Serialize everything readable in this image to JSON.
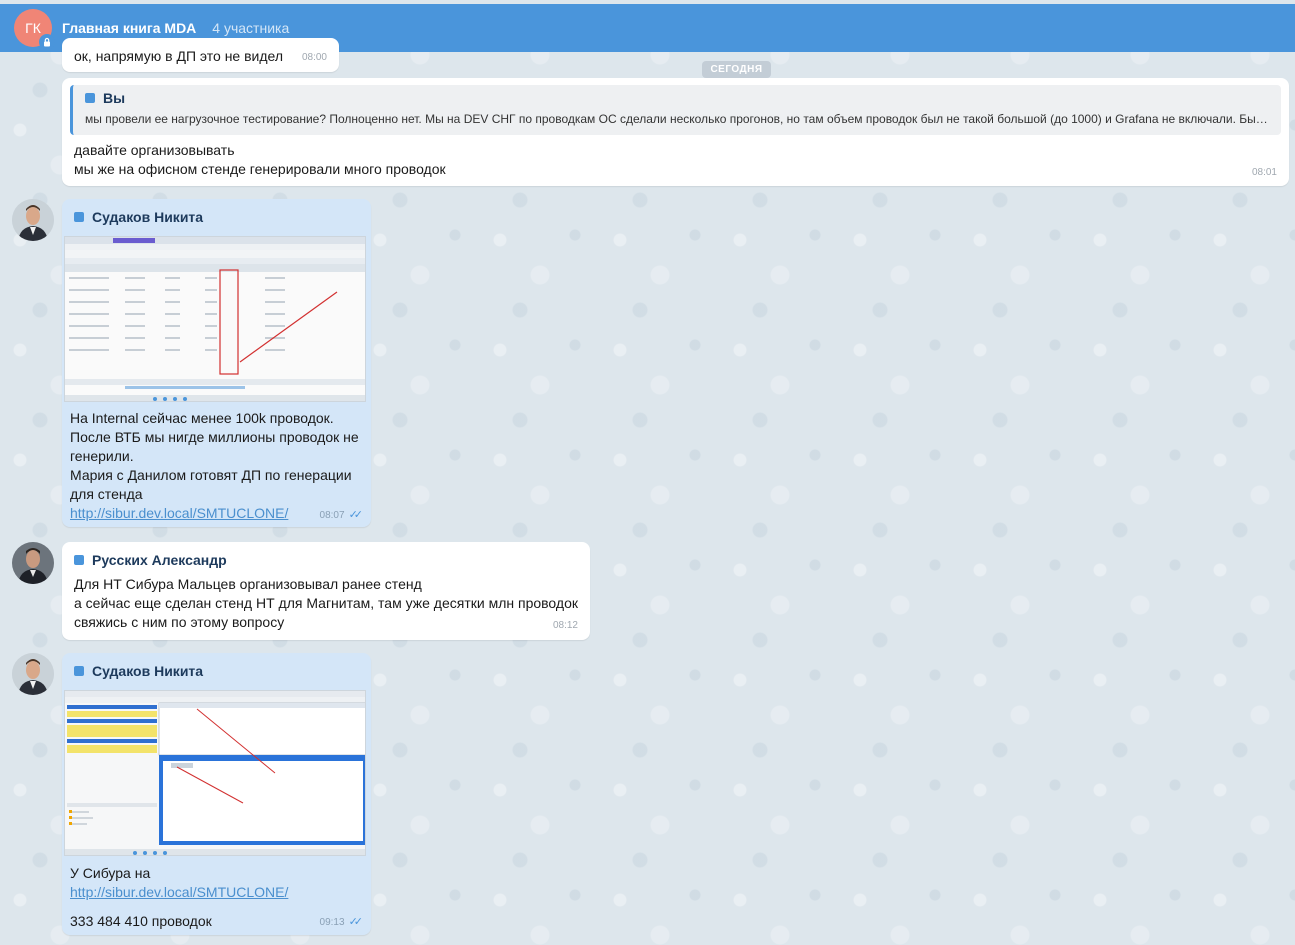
{
  "header": {
    "avatar_initials": "ГК",
    "title": "Главная книга MDA",
    "members": "4 участника"
  },
  "date_separator": "СЕГОДНЯ",
  "messages": [
    {
      "text": "ок, напрямую в ДП это не видел",
      "time": "08:00"
    },
    {
      "reply_sender": "Вы",
      "reply_text": "мы провели ее нагрузочное тестирование? Полноценно нет. Мы на DEV СНГ по проводкам ОС сделали несколько прогонов, но там объем проводок был не такой большой (до 1000) и Grafana не включали. Было …",
      "lines": [
        "давайте организовывать",
        "мы же на офисном стенде генерировали много проводок"
      ],
      "time": "08:01"
    },
    {
      "sender": "Судаков Никита",
      "lines": [
        "На Internal сейчас менее 100k проводок.",
        "После ВТБ мы нигде миллионы проводок не",
        "генерили.",
        "Мария с Данилом готовят ДП по генерации",
        "для стенда"
      ],
      "link": "http://sibur.dev.local/SMTUCLONE/",
      "time": "08:07"
    },
    {
      "sender": "Русских Александр",
      "lines": [
        "Для НТ Сибура Мальцев организовывал ранее стенд",
        "а сейчас еще сделан стенд НТ для Магнитам, там уже десятки млн проводок",
        "свяжись с ним по этому вопросу"
      ],
      "time": "08:12"
    },
    {
      "sender": "Судаков Никита",
      "lines": [
        "У Сибура на"
      ],
      "link": "http://sibur.dev.local/SMTUCLONE/",
      "extra": "333 484 410 проводок",
      "time": "09:13"
    }
  ],
  "colors": {
    "header": "#4a95db",
    "own_bubble": "#d4e6f8",
    "link": "#4a8fce"
  }
}
